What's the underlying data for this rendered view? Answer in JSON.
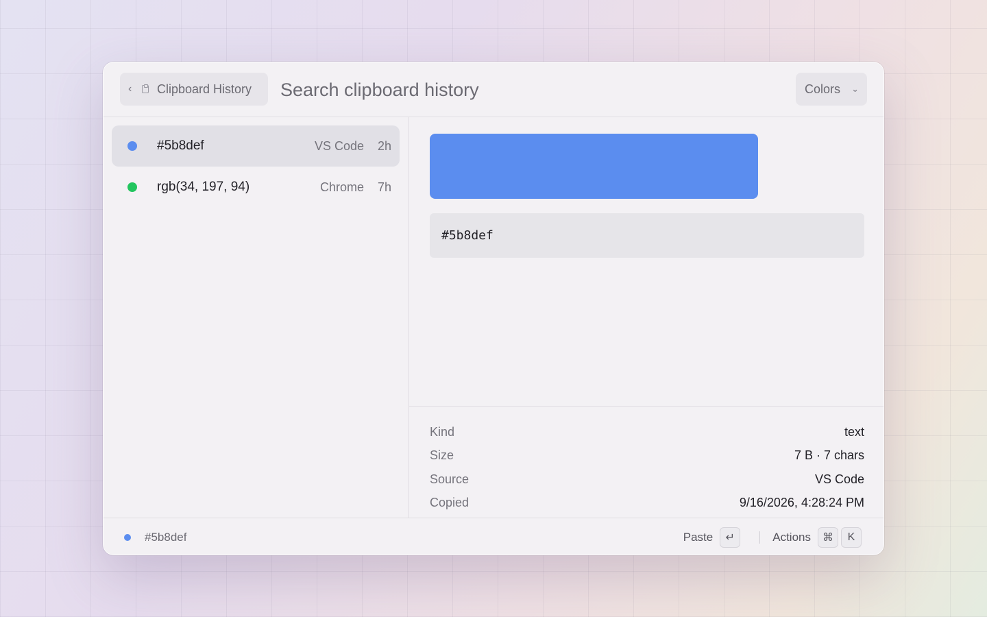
{
  "header": {
    "back_label": "Clipboard History",
    "search_placeholder": "Search clipboard history",
    "filter_value": "Colors"
  },
  "list": {
    "items": [
      {
        "value": "#5b8def",
        "color": "#5b8def",
        "source": "VS Code",
        "time": "2h",
        "selected": true
      },
      {
        "value": "rgb(34, 197, 94)",
        "color": "#22c55e",
        "source": "Chrome",
        "time": "7h",
        "selected": false
      }
    ]
  },
  "detail": {
    "swatch_color": "#5b8def",
    "code": "#5b8def",
    "meta": [
      {
        "key": "Kind",
        "value": "text"
      },
      {
        "key": "Size",
        "value": "7 B · 7 chars"
      },
      {
        "key": "Source",
        "value": "VS Code"
      },
      {
        "key": "Copied",
        "value": "9/16/2026, 4:28:24 PM"
      }
    ]
  },
  "footer": {
    "selected_color": "#5b8def",
    "selected_value": "#5b8def",
    "paste_label": "Paste",
    "paste_key": "↵",
    "actions_label": "Actions",
    "actions_keys": [
      "⌘",
      "K"
    ]
  }
}
